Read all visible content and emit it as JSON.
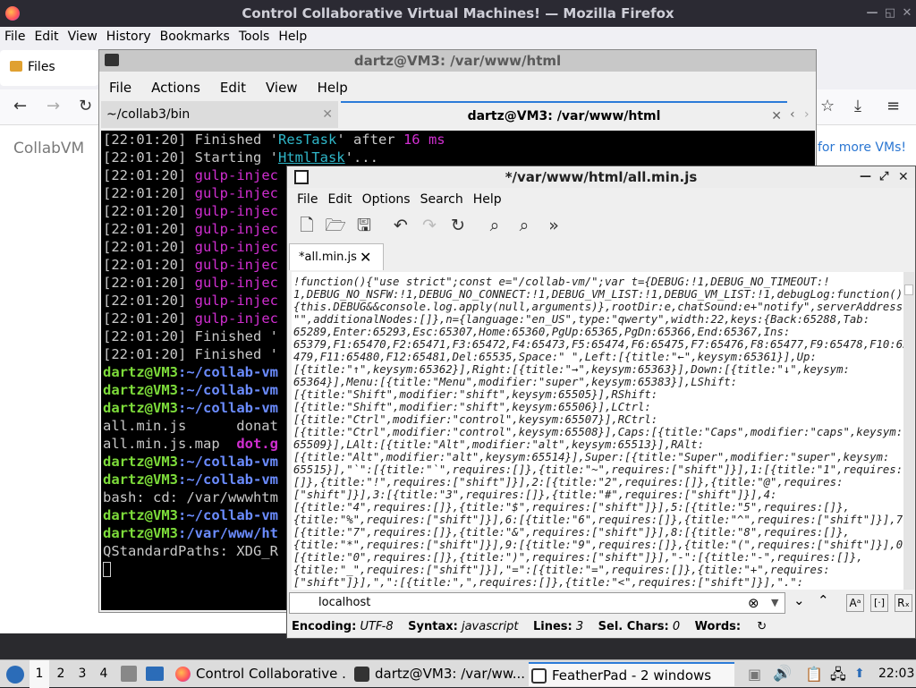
{
  "firefox": {
    "title": "Control Collaborative Virtual Machines! — Mozilla Firefox",
    "menu": [
      "File",
      "Edit",
      "View",
      "History",
      "Bookmarks",
      "Tools",
      "Help"
    ],
    "tab_label": "Files",
    "page_brand": "CollabVM",
    "page_link_partial": "for more VMs!"
  },
  "terminal": {
    "title": "dartz@VM3: /var/www/html",
    "menu": [
      "File",
      "Actions",
      "Edit",
      "View",
      "Help"
    ],
    "tabs": [
      {
        "label": "~/collab3/bin"
      },
      {
        "label": "dartz@VM3: /var/www/html"
      }
    ],
    "lines": [
      {
        "t": "[22:01:20]",
        "rest": " Finished '",
        "task": "ResTask",
        "after": "' after ",
        "num": "16 ms"
      },
      {
        "t": "[22:01:20]",
        "rest": " Starting '",
        "taskc": "HtmlTask",
        "after": "'..."
      },
      {
        "t": "[22:01:20]",
        "mag": " gulp-injec"
      },
      {
        "t": "[22:01:20]",
        "mag": " gulp-injec"
      },
      {
        "t": "[22:01:20]",
        "mag": " gulp-injec"
      },
      {
        "t": "[22:01:20]",
        "mag": " gulp-injec"
      },
      {
        "t": "[22:01:20]",
        "mag": " gulp-injec"
      },
      {
        "t": "[22:01:20]",
        "mag": " gulp-injec"
      },
      {
        "t": "[22:01:20]",
        "mag": " gulp-injec"
      },
      {
        "t": "[22:01:20]",
        "mag": " gulp-injec"
      },
      {
        "t": "[22:01:20]",
        "mag": " gulp-injec"
      },
      {
        "t": "[22:01:20]",
        "rest": " Finished '"
      },
      {
        "t": "[22:01:20]",
        "rest": " Finished '"
      },
      {
        "user": "dartz@VM3",
        "path": ":~/collab-vm"
      },
      {
        "user": "dartz@VM3",
        "path": ":~/collab-vm"
      },
      {
        "user": "dartz@VM3",
        "path": ":~/collab-vm"
      },
      {
        "plain": "all.min.js      donat"
      },
      {
        "plain": "all.min.js.map  ",
        "magb": "dot.g"
      },
      {
        "user": "dartz@VM3",
        "path": ":~/collab-vm"
      },
      {
        "user": "dartz@VM3",
        "path": ":~/collab-vm"
      },
      {
        "plain": "bash: cd: /var/wwwhtm"
      },
      {
        "user": "dartz@VM3",
        "path": ":~/collab-vm"
      },
      {
        "user": "dartz@VM3",
        "path": ":/var/www/ht"
      },
      {
        "plain": "QStandardPaths: XDG_R"
      }
    ]
  },
  "featherpad": {
    "title": "*/var/www/html/all.min.js",
    "menu": [
      "File",
      "Edit",
      "Options",
      "Search",
      "Help"
    ],
    "tab_label": "*all.min.js",
    "code_lines": [
      "!function(){\"use strict\";const e=\"/collab-vm/\";var t={DEBUG:!1,DEBUG_NO_TIMEOUT:!",
      "1,DEBUG_NO_NSFW:!1,DEBUG_NO_CONNECT:!1,DEBUG_VM_LIST:!1,DEBUG_VM_LIST:!1,debugLog:function()",
      "{this.DEBUG&&console.log.apply(null,arguments)},rootDir:e,chatSound:e+\"notify\",serverAddress:",
      "\"\",additionalNodes:[]},n={language:\"en_US\",type:\"qwerty\",width:22,keys:{Back:65288,Tab:",
      "65289,Enter:65293,Esc:65307,Home:65360,PgUp:65365,PgDn:65366,End:65367,Ins:",
      "65379,F1:65470,F2:65471,F3:65472,F4:65473,F5:65474,F6:65475,F7:65476,F8:65477,F9:65478,F10:65",
      "479,F11:65480,F12:65481,Del:65535,Space:\" \",Left:[{title:\"←\",keysym:65361}],Up:",
      "[{title:\"↑\",keysym:65362}],Right:[{title:\"→\",keysym:65363}],Down:[{title:\"↓\",keysym:",
      "65364}],Menu:[{title:\"Menu\",modifier:\"super\",keysym:65383}],LShift:",
      "[{title:\"Shift\",modifier:\"shift\",keysym:65505}],RShift:",
      "[{title:\"Shift\",modifier:\"shift\",keysym:65506}],LCtrl:",
      "[{title:\"Ctrl\",modifier:\"control\",keysym:65507}],RCtrl:",
      "[{title:\"Ctrl\",modifier:\"control\",keysym:65508}],Caps:[{title:\"Caps\",modifier:\"caps\",keysym:",
      "65509}],LAlt:[{title:\"Alt\",modifier:\"alt\",keysym:65513}],RAlt:",
      "[{title:\"Alt\",modifier:\"alt\",keysym:65514}],Super:[{title:\"Super\",modifier:\"super\",keysym:",
      "65515}],\"`\":[{title:\"`\",requires:[]},{title:\"~\",requires:[\"shift\"]}],1:[{title:\"1\",requires:",
      "[]},{title:\"!\",requires:[\"shift\"]}],2:[{title:\"2\",requires:[]},{title:\"@\",requires:",
      "[\"shift\"]}],3:[{title:\"3\",requires:[]},{title:\"#\",requires:[\"shift\"]}],4:",
      "[{title:\"4\",requires:[]},{title:\"$\",requires:[\"shift\"]}],5:[{title:\"5\",requires:[]},",
      "{title:\"%\",requires:[\"shift\"]}],6:[{title:\"6\",requires:[]},{title:\"^\",requires:[\"shift\"]}],7:",
      "[{title:\"7\",requires:[]},{title:\"&\",requires:[\"shift\"]}],8:[{title:\"8\",requires:[]},",
      "{title:\"*\",requires:[\"shift\"]}],9:[{title:\"9\",requires:[]},{title:\"(\",requires:[\"shift\"]}],0:",
      "[{title:\"0\",requires:[]},{title:\")\",requires:[\"shift\"]}],\"-\":[{title:\"-\",requires:[]},",
      "{title:\"_\",requires:[\"shift\"]}],\"=\":[{title:\"=\",requires:[]},{title:\"+\",requires:",
      "[\"shift\"]}],\",\":[{title:\",\",requires:[]},{title:\"<\",requires:[\"shift\"]}],\".\":"
    ],
    "search_value": "localhost",
    "status": {
      "encoding_label": "Encoding:",
      "encoding": "UTF-8",
      "syntax_label": "Syntax:",
      "syntax": "javascript",
      "lines_label": "Lines:",
      "lines": "3",
      "sel_label": "Sel. Chars:",
      "sel": "0",
      "words_label": "Words:"
    }
  },
  "taskbar": {
    "workspaces": [
      "1",
      "2",
      "3",
      "4"
    ],
    "tasks": [
      {
        "label": "Control Collaborative ..."
      },
      {
        "label": "dartz@VM3: /var/ww..."
      },
      {
        "label": "FeatherPad - 2 windows"
      }
    ],
    "clock": "22:03"
  },
  "colors": {
    "accent": "#2b7bd8",
    "term_green": "#7ddc3a",
    "term_blue": "#6b8cff",
    "term_magenta": "#d02ed0"
  }
}
